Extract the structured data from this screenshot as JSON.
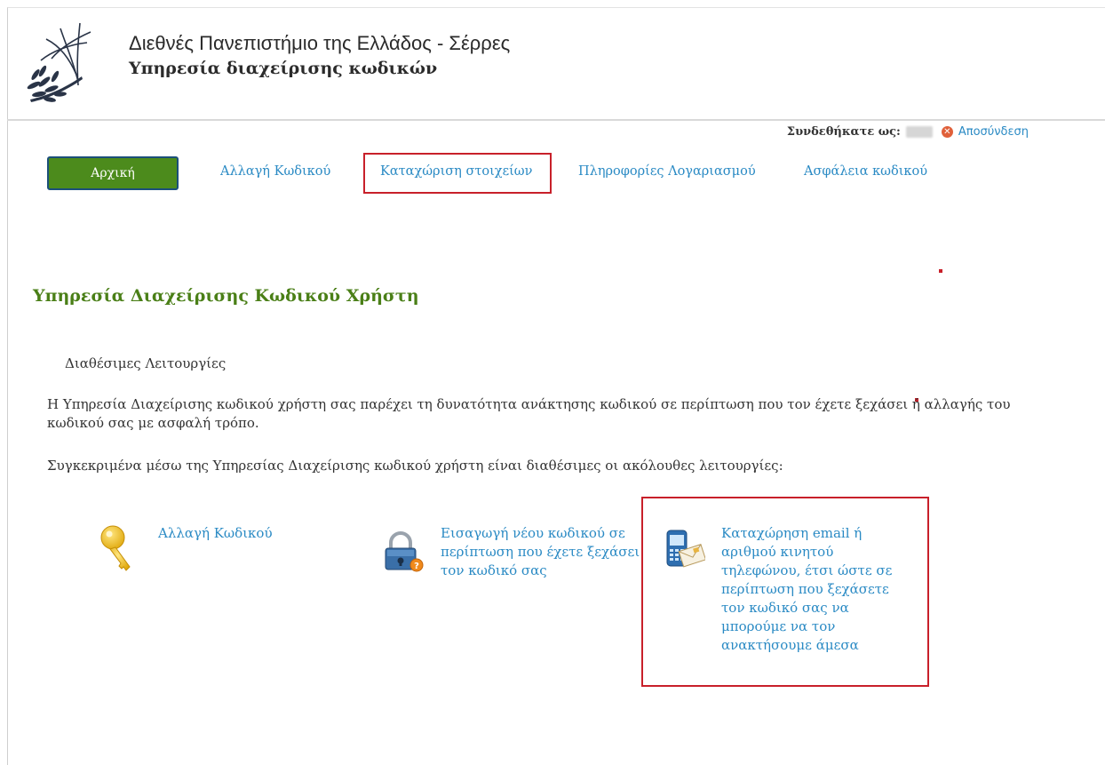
{
  "header": {
    "university": "Διεθνές Πανεπιστήμιο της Ελλάδος - Σέρρες",
    "service": "Υπηρεσία διαχείρισης κωδικών"
  },
  "login": {
    "label": "Συνδεθήκατε ως:",
    "logout": "Αποσύνδεση"
  },
  "nav": {
    "home": "Αρχική",
    "change_password": "Αλλαγή Κωδικού",
    "register_details": "Καταχώριση στοιχείων",
    "account_info": "Πληροφορίες Λογαριασμού",
    "password_security": "Ασφάλεια κωδικού"
  },
  "main": {
    "title": "Υπηρεσία Διαχείρισης Κωδικού Χρήστη",
    "features_heading": "Διαθέσιμες Λειτουργίες",
    "intro": "Η Υπηρεσία Διαχείρισης κωδικού χρήστη σας παρέχει τη δυνατότητα ανάκτησης κωδικού σε περίπτωση που τον έχετε ξεχάσει ή αλλαγής του κωδικού σας με ασφαλή τρόπο.",
    "specifically": "Συγκεκριμένα μέσω της Υπηρεσίας Διαχείρισης κωδικού χρήστη είναι διαθέσιμες οι ακόλουθες λειτουργίες:",
    "features": [
      {
        "icon": "key-icon",
        "label": "Αλλαγή Κωδικού"
      },
      {
        "icon": "padlock-icon",
        "label": "Εισαγωγή νέου κωδικού σε περίπτωση που έχετε ξεχάσει τον κωδικό σας"
      },
      {
        "icon": "phone-email-icon",
        "label": "Καταχώρηση email ή αριθμού κινητού τηλεφώνου, έτσι ώστε σε περίπτωση που ξεχάσετε τον κωδικό σας να μπορούμε να τον ανακτήσουμε άμεσα"
      }
    ]
  },
  "colors": {
    "accent_green": "#4c8b1c",
    "title_green": "#4a7f17",
    "link_blue": "#2a8ac4",
    "highlight_red": "#c8202a"
  }
}
